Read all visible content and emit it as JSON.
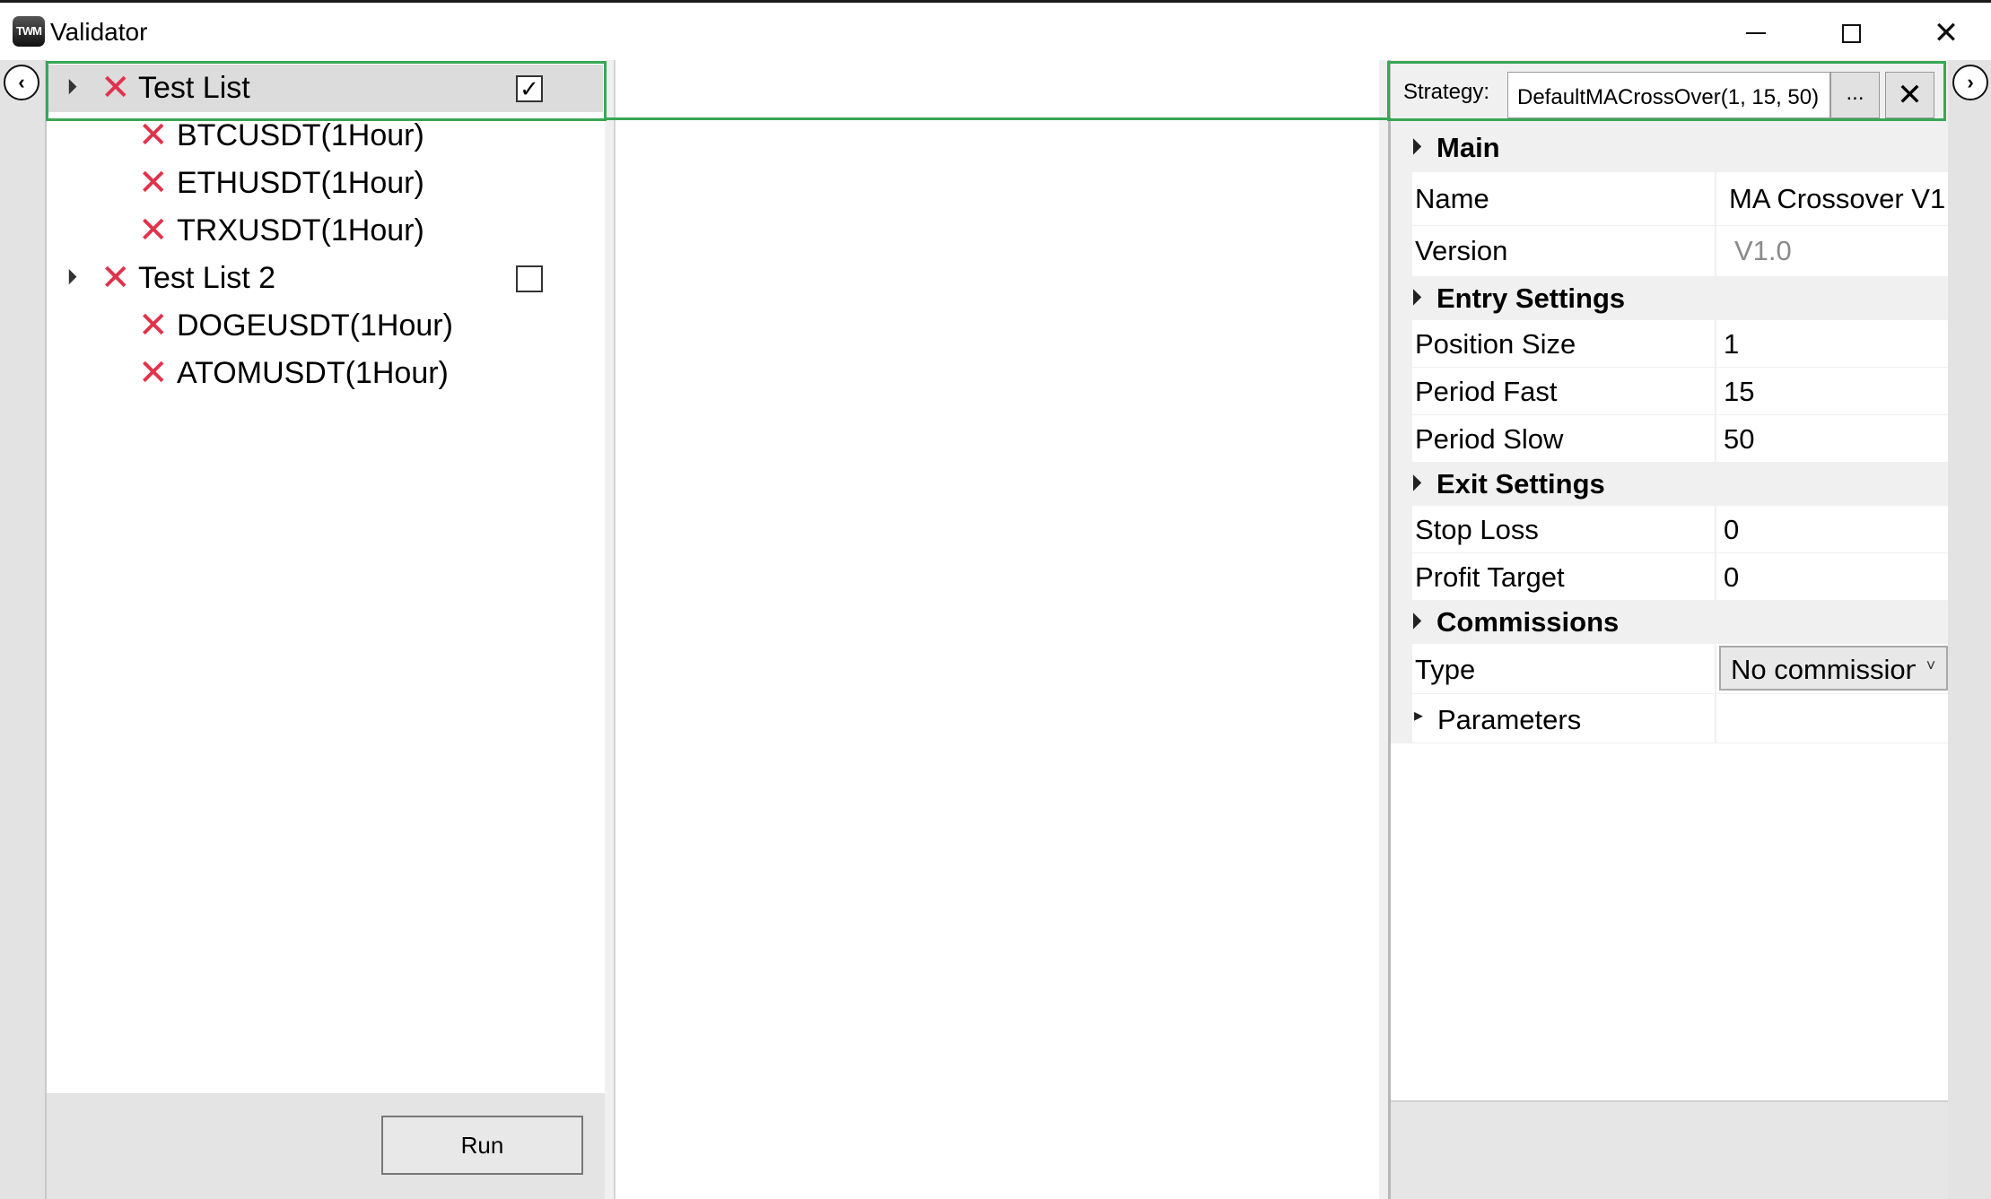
{
  "window": {
    "logo_text": "TWM",
    "title": "Validator",
    "controls": {
      "minimize_icon": "minimize-icon",
      "maximize_icon": "maximize-icon",
      "close_glyph": "✕"
    }
  },
  "nav": {
    "left_glyph": "‹",
    "right_glyph": "›"
  },
  "test_lists": [
    {
      "name": "Test List",
      "checked": true,
      "check_glyph": "✓",
      "status": "failed",
      "items": [
        "BTCUSDT(1Hour)",
        "ETHUSDT(1Hour)",
        "TRXUSDT(1Hour)"
      ]
    },
    {
      "name": "Test List 2",
      "checked": false,
      "check_glyph": "",
      "status": "failed",
      "items": [
        "DOGEUSDT(1Hour)",
        "ATOMUSDT(1Hour)"
      ]
    }
  ],
  "status_glyph": "✕",
  "run_button_label": "Run",
  "strategy": {
    "label": "Strategy:",
    "value": "DefaultMACrossOver(1, 15, 50)",
    "browse_label": "...",
    "clear_glyph": "✕"
  },
  "property_grid": {
    "main": {
      "label": "Main",
      "name_label": "Name",
      "name_value": "MA Crossover V1",
      "version_label": "Version",
      "version_value": "V1.0"
    },
    "entry": {
      "label": "Entry Settings",
      "position_size_label": "Position Size",
      "position_size_value": "1",
      "period_fast_label": "Period Fast",
      "period_fast_value": "15",
      "period_slow_label": "Period Slow",
      "period_slow_value": "50"
    },
    "exit": {
      "label": "Exit Settings",
      "stop_loss_label": "Stop Loss",
      "stop_loss_value": "0",
      "profit_target_label": "Profit Target",
      "profit_target_value": "0"
    },
    "commissions": {
      "label": "Commissions",
      "type_label": "Type",
      "type_value": "No commission",
      "parameters_label": "Parameters"
    },
    "expand_glyph": "◢",
    "collapsed_glyph": "▸",
    "dropdown_glyph": "˅"
  },
  "colors": {
    "error_red": "#e0334b",
    "highlight_green": "#3aa655",
    "selected_row": "#dcdcdc"
  }
}
